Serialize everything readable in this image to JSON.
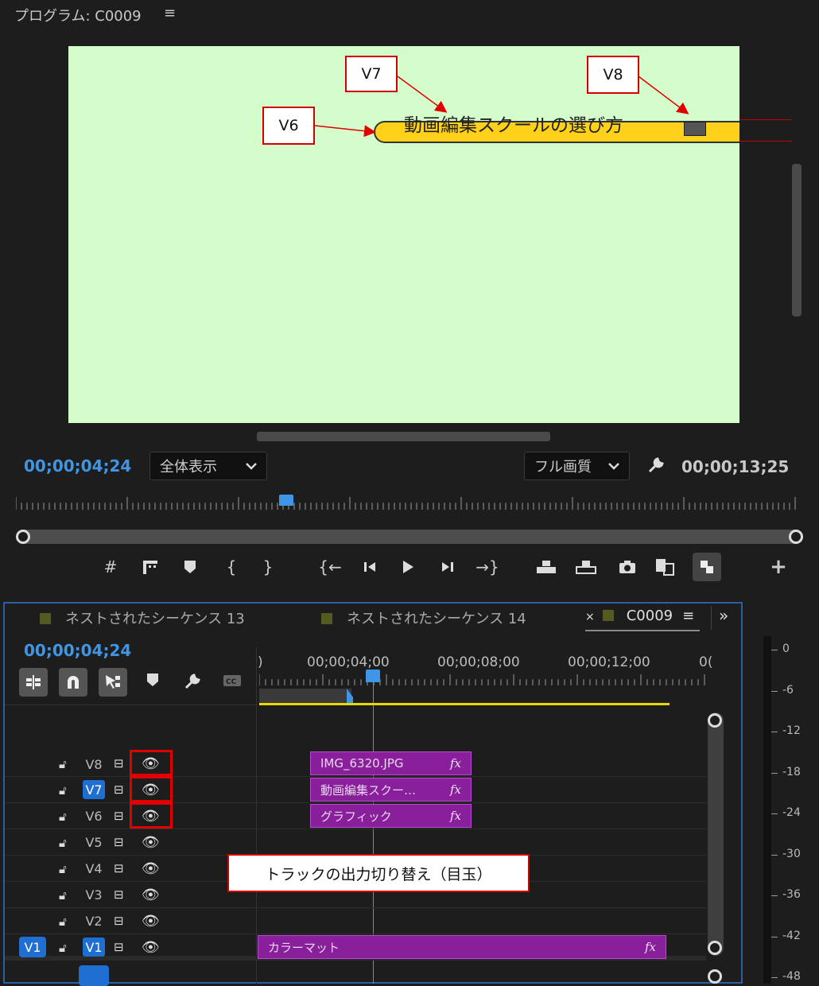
{
  "program_monitor": {
    "title": "プログラム: C0009",
    "menu_icon": "≡",
    "title_overlay": "動画編集スクールの選び方",
    "current_timecode": "00;00;04;24",
    "fit_dropdown": "全体表示",
    "quality_dropdown": "フル画質",
    "duration_timecode": "00;00;13;25",
    "playhead_fraction": 0.346,
    "frame_color": "#d5fdcb",
    "bar_color": "#ffd11a"
  },
  "annotations": {
    "v6": "V6",
    "v7": "V7",
    "v8": "V8",
    "eye_note": "トラックの出力切り替え（目玉）",
    "callout_color": "#d00000"
  },
  "transport": {
    "icons": [
      "marker-grid-icon",
      "add-marker-icon",
      "marker-icon",
      "mark-in-icon",
      "mark-out-icon",
      "go-to-in-icon",
      "step-back-icon",
      "play-icon",
      "step-forward-icon",
      "go-to-out-icon",
      "lift-icon",
      "extract-icon",
      "export-frame-icon",
      "insert-icon",
      "overwrite-toggle-icon",
      "add-button-icon"
    ]
  },
  "timeline": {
    "tabs": [
      {
        "label": "ネストされたシーケンス 13"
      },
      {
        "label": "ネストされたシーケンス 14"
      },
      {
        "label": "C0009",
        "close": "×",
        "menu": "≡"
      }
    ],
    "overflow": "»",
    "timecode": "00;00;04;24",
    "ruler_labels": [
      ")",
      "00;00;04;00",
      "00;00;08;00",
      "00;00;12;00",
      "0("
    ],
    "tracks": [
      {
        "name": "V8",
        "active": false,
        "clip": "IMG_6320.JPG",
        "fx": "fx"
      },
      {
        "name": "V7",
        "active": true,
        "clip": "動画編集スクー…",
        "fx": "fx"
      },
      {
        "name": "V6",
        "active": false,
        "clip": "グラフィック",
        "fx": "fx"
      },
      {
        "name": "V5",
        "active": false
      },
      {
        "name": "V4",
        "active": false
      },
      {
        "name": "V3",
        "active": false
      },
      {
        "name": "V2",
        "active": false
      },
      {
        "name": "V1",
        "active": true,
        "clip": "カラーマット",
        "fx": "fx",
        "source": "V1"
      }
    ],
    "clip_color": "#8a1f9c",
    "accent_color": "#3f95e6"
  },
  "audio_meter": {
    "labels": [
      "0",
      "-6",
      "-12",
      "-18",
      "-24",
      "-30",
      "-36",
      "-42",
      "-48"
    ]
  }
}
